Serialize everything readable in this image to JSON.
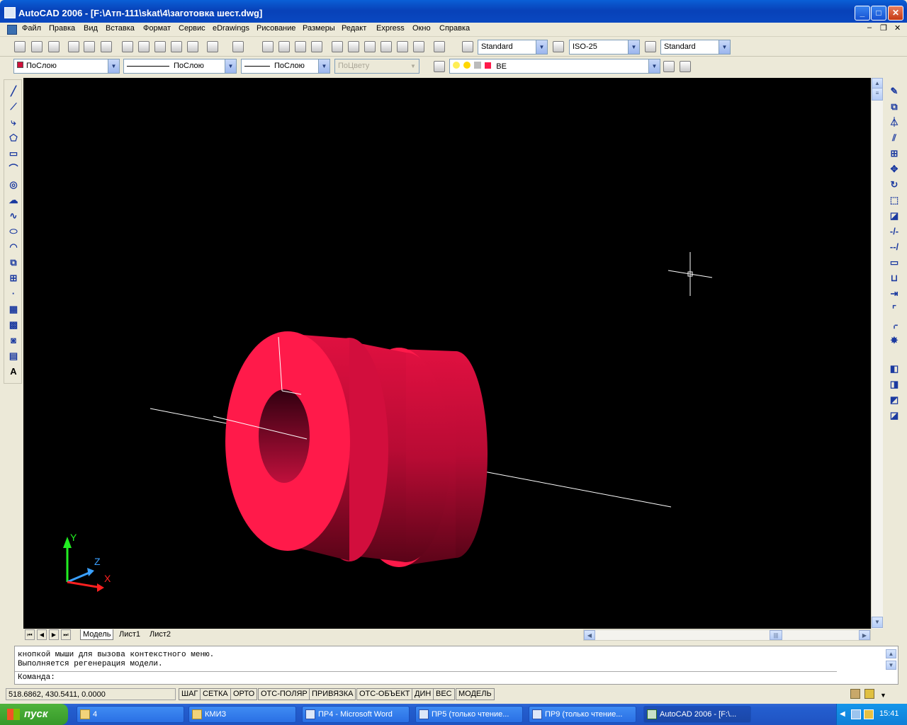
{
  "window": {
    "title": "AutoCAD 2006 - [F:\\Атп-111\\skat\\4\\заготовка шест.dwg]"
  },
  "menu": [
    "Файл",
    "Правка",
    "Вид",
    "Вставка",
    "Формат",
    "Сервис",
    "eDrawings",
    "Рисование",
    "Размеры",
    "Редакт",
    "Express",
    "Окно",
    "Справка"
  ],
  "toolbar": {
    "text_style": "Standard",
    "dim_style": "ISO-25",
    "table_style": "Standard"
  },
  "properties": {
    "color": "ПоСлою",
    "linetype": "ПоСлою",
    "lineweight": "ПоСлою",
    "plot_style": "ПоЦвету",
    "layer": "ВЕ"
  },
  "tabs": [
    "Модель",
    "Лист1",
    "Лист2"
  ],
  "command": {
    "line1": "кнопкой мыши для вызова контекстного меню.",
    "line2": "Выполняется регенерация модели.",
    "prompt": "Команда:"
  },
  "status": {
    "coords": "518.6862, 430.5411, 0.0000",
    "buttons": [
      "ШАГ",
      "СЕТКА",
      "ОРТО",
      "ОТС-ПОЛЯР",
      "ПРИВЯЗКА",
      "ОТС-ОБЪЕКТ",
      "ДИН",
      "ВЕС",
      "МОДЕЛЬ"
    ]
  },
  "ucs": {
    "y": "Y",
    "z": "Z",
    "x": "X"
  },
  "taskbar": {
    "start": "пуск",
    "items": [
      "4",
      "КМИЗ",
      "ПР4 - Microsoft Word",
      "ПР5 (только чтение...",
      "ПР9 (только чтение...",
      "AutoCAD 2006 - [F:\\..."
    ],
    "clock": "15:41"
  },
  "colors": {
    "model": "#ff1a4a",
    "viewport": "#000000"
  }
}
